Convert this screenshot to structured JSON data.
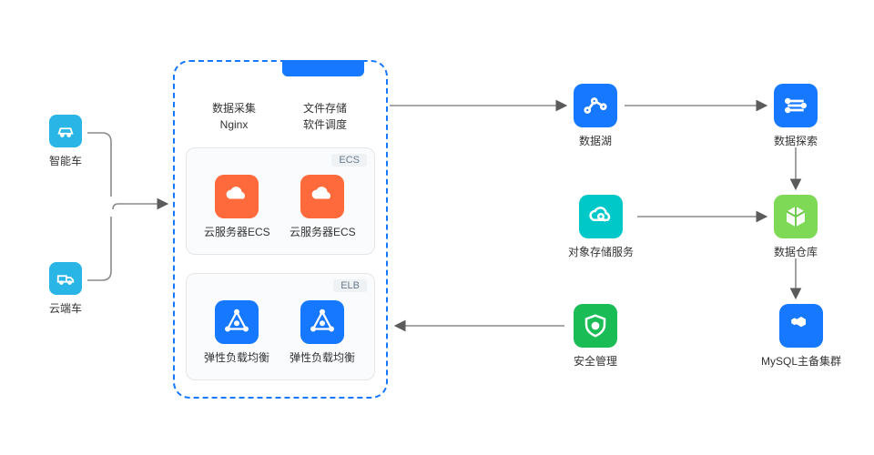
{
  "left": {
    "car": "智能车",
    "truck": "云端车"
  },
  "center": {
    "header1_l1": "数据采集",
    "header1_l2": "Nginx",
    "header2_l1": "文件存储",
    "header2_l2": "软件调度",
    "ecs_badge": "ECS",
    "ecs_label": "云服务器ECS",
    "elb_badge": "ELB",
    "elb_label": "弹性负载均衡"
  },
  "right": {
    "datalake": "数据湖",
    "datasearch": "数据探索",
    "storage": "对象存储服务",
    "compute": "数据仓库",
    "security": "安全管理",
    "db": "MySQL主备集群"
  }
}
